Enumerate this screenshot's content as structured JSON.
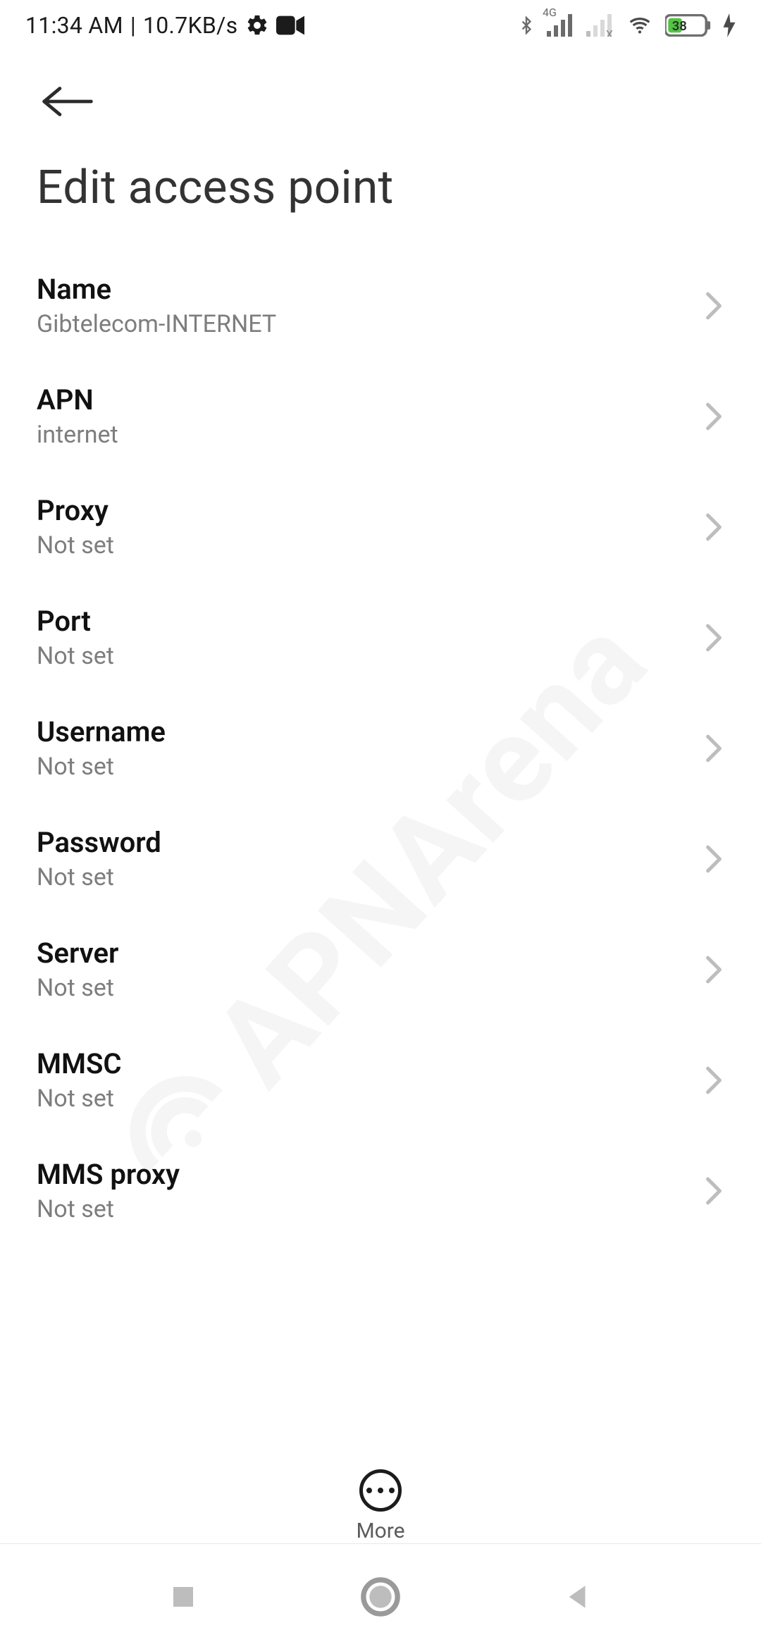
{
  "status": {
    "time": "11:34 AM",
    "net_speed": "10.7KB/s",
    "battery_pct": "38"
  },
  "icons": {
    "settings": "gear-icon",
    "camera": "camera-icon",
    "bluetooth": "bluetooth-icon",
    "sim1_label": "4G",
    "wifi": "wifi-icon",
    "battery": "battery-icon",
    "charging": "charging-icon"
  },
  "header": {
    "title": "Edit access point"
  },
  "rows": [
    {
      "label": "Name",
      "value": "Gibtelecom-INTERNET"
    },
    {
      "label": "APN",
      "value": "internet"
    },
    {
      "label": "Proxy",
      "value": "Not set"
    },
    {
      "label": "Port",
      "value": "Not set"
    },
    {
      "label": "Username",
      "value": "Not set"
    },
    {
      "label": "Password",
      "value": "Not set"
    },
    {
      "label": "Server",
      "value": "Not set"
    },
    {
      "label": "MMSC",
      "value": "Not set"
    },
    {
      "label": "MMS proxy",
      "value": "Not set"
    }
  ],
  "action": {
    "more_label": "More"
  },
  "watermark": "APNArena"
}
